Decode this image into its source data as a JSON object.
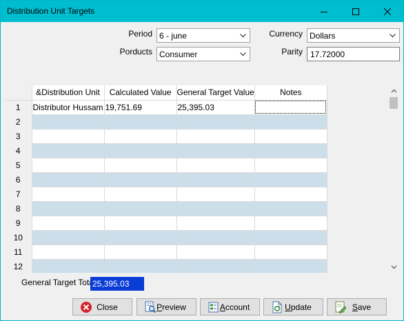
{
  "window": {
    "title": "Distribution Unit Targets"
  },
  "form": {
    "period": {
      "label": "Period",
      "value": "6 - june"
    },
    "products": {
      "label": "Porducts",
      "value": "Consumer"
    },
    "currency": {
      "label": "Currency",
      "value": "Dollars"
    },
    "parity": {
      "label": "Parity",
      "value": "17.72000"
    }
  },
  "grid": {
    "columns": [
      "&Distribution Unit",
      "Calculated Value",
      "General Target Value",
      "Notes"
    ],
    "rows": [
      {
        "n": "1",
        "unit": "Distributor Hussam",
        "calc": "19,751.69",
        "target": "25,395.03",
        "notes": ""
      },
      {
        "n": "2",
        "unit": "",
        "calc": "",
        "target": "",
        "notes": ""
      },
      {
        "n": "3",
        "unit": "",
        "calc": "",
        "target": "",
        "notes": ""
      },
      {
        "n": "4",
        "unit": "",
        "calc": "",
        "target": "",
        "notes": ""
      },
      {
        "n": "5",
        "unit": "",
        "calc": "",
        "target": "",
        "notes": ""
      },
      {
        "n": "6",
        "unit": "",
        "calc": "",
        "target": "",
        "notes": ""
      },
      {
        "n": "7",
        "unit": "",
        "calc": "",
        "target": "",
        "notes": ""
      },
      {
        "n": "8",
        "unit": "",
        "calc": "",
        "target": "",
        "notes": ""
      },
      {
        "n": "9",
        "unit": "",
        "calc": "",
        "target": "",
        "notes": ""
      },
      {
        "n": "10",
        "unit": "",
        "calc": "",
        "target": "",
        "notes": ""
      },
      {
        "n": "11",
        "unit": "",
        "calc": "",
        "target": "",
        "notes": ""
      },
      {
        "n": "12",
        "unit": "",
        "calc": "",
        "target": "",
        "notes": ""
      }
    ]
  },
  "total": {
    "label": "General Target Total",
    "value": "25,395.03"
  },
  "buttons": {
    "close": {
      "label": "Close",
      "icon": "close-x-icon"
    },
    "preview": {
      "label_mn": "P",
      "label_rest": "review",
      "icon": "preview-icon"
    },
    "account": {
      "label_mn": "A",
      "label_rest": "ccount",
      "icon": "account-icon"
    },
    "update": {
      "label_mn": "U",
      "label_rest": "pdate",
      "icon": "update-icon"
    },
    "save": {
      "label_mn": "S",
      "label_rest": "ave",
      "icon": "save-icon"
    }
  },
  "colors": {
    "titlebar": "#00bed0",
    "alt_row": "#cddeeb",
    "total_highlight": "#0a3cd6",
    "close_icon": "#d4222a"
  }
}
